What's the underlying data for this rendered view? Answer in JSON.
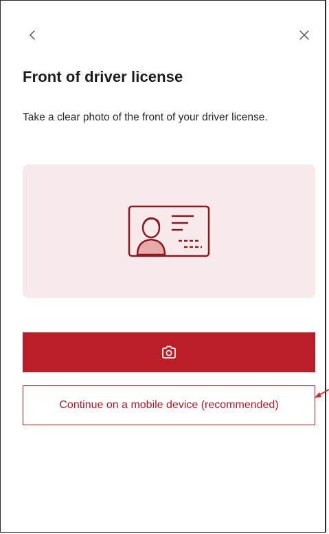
{
  "header": {
    "back_icon": "chevron-left-icon",
    "close_icon": "close-icon"
  },
  "content": {
    "title": "Front of driver license",
    "description": "Take a clear photo of the front of your driver license.",
    "illustration_icon": "id-card-icon"
  },
  "actions": {
    "camera_icon": "camera-icon",
    "mobile_label": "Continue on a mobile device (recommended)"
  },
  "colors": {
    "accent": "#bb1e29",
    "card_background": "#f8e9ea",
    "icon_dark": "#8b1a22",
    "annotation_arrow": "#e0202a"
  }
}
